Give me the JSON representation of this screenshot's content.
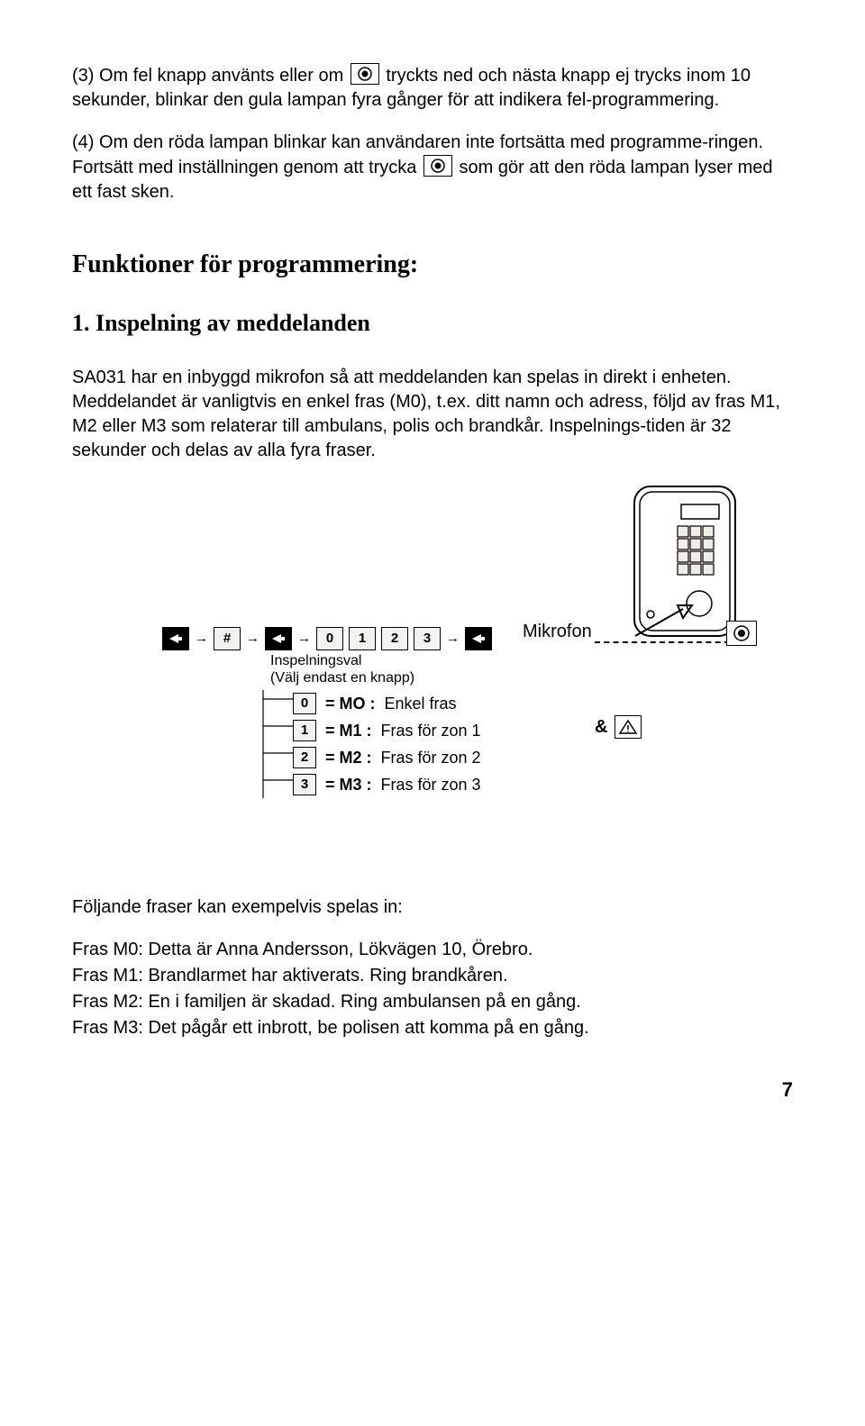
{
  "para3_a": "(3) Om fel knapp använts eller om",
  "para3_b": "tryckts ned och nästa knapp ej trycks inom 10 sekunder, blinkar den gula lampan fyra gånger för att indikera fel-programmering.",
  "para4_a": "(4) Om den röda lampan blinkar kan användaren inte fortsätta med programme-ringen. Fortsätt med inställningen genom att trycka",
  "para4_b": "som gör att den röda lampan lyser med ett fast sken.",
  "section_heading": "Funktioner för programmering:",
  "sub_heading": "1. Inspelning av meddelanden",
  "intro_para": "SA031 har en inbyggd mikrofon så att meddelanden kan spelas in direkt i enheten. Meddelandet är vanligtvis en enkel fras (M0), t.ex. ditt namn och  adress, följd av fras M1, M2 eller M3 som relaterar till ambulans, polis och brandkår. Inspelnings-tiden är 32 sekunder och delas av alla fyra fraser.",
  "diagram": {
    "mic_label": "Mikrofon",
    "insp_label_1": "Inspelningsval",
    "insp_label_2": "(Välj endast en knapp)",
    "key_hash": "#",
    "key_0": "0",
    "key_1": "1",
    "key_2": "2",
    "key_3": "3",
    "choices": [
      {
        "k": "0",
        "code": "= MO :",
        "text": "Enkel fras"
      },
      {
        "k": "1",
        "code": "= M1 :",
        "text": "Fras för zon 1"
      },
      {
        "k": "2",
        "code": "= M2 :",
        "text": "Fras för zon 2"
      },
      {
        "k": "3",
        "code": "= M3 :",
        "text": "Fras för zon 3"
      }
    ],
    "amp": "&"
  },
  "followup_intro": "Följande fraser kan exempelvis spelas in:",
  "phrases": {
    "m0": "Fras M0: Detta är Anna Andersson, Lökvägen 10, Örebro.",
    "m1": "Fras M1: Brandlarmet har aktiverats. Ring brandkåren.",
    "m2": "Fras M2: En i familjen är skadad. Ring ambulansen på en gång.",
    "m3": "Fras M3: Det pågår ett inbrott, be polisen att komma på en gång."
  },
  "page_num": "7"
}
